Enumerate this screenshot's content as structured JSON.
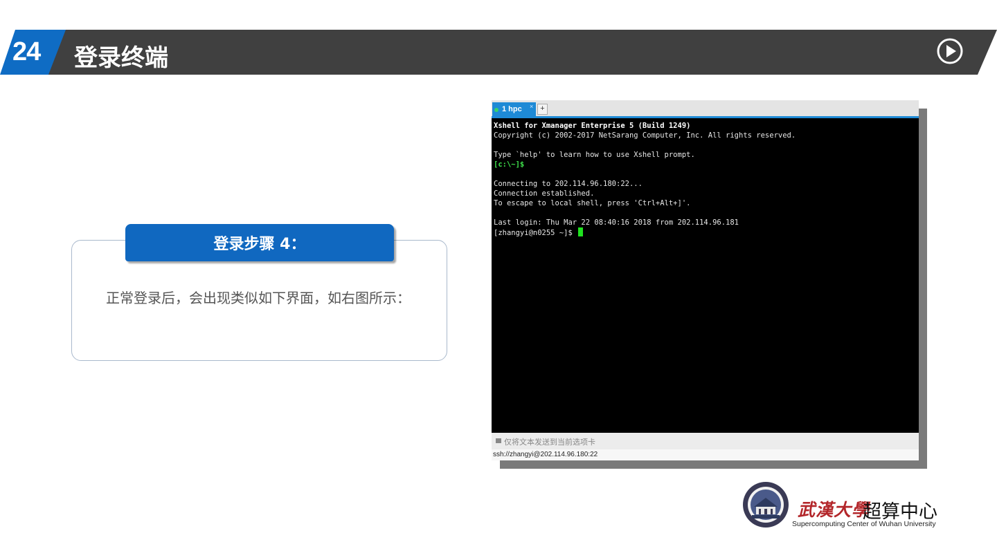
{
  "header": {
    "slide_number": "24",
    "title": "登录终端",
    "play_icon": "play-circle-icon"
  },
  "step_card": {
    "heading": "登录步骤 4：",
    "body": "正常登录后，会出现类似如下界面，如右图所示："
  },
  "terminal": {
    "tab_label": "1 hpc",
    "tab_close": "×",
    "tab_add": "+",
    "lines": [
      {
        "text": "Xshell for Xmanager Enterprise 5 (Build 1249)",
        "style": "bold"
      },
      {
        "text": "Copyright (c) 2002-2017 NetSarang Computer, Inc. All rights reserved.",
        "style": "normal"
      },
      {
        "text": "",
        "style": "normal"
      },
      {
        "text": "Type `help' to learn how to use Xshell prompt.",
        "style": "normal"
      },
      {
        "text": "[c:\\~]$",
        "style": "green"
      },
      {
        "text": "",
        "style": "normal"
      },
      {
        "text": "Connecting to 202.114.96.180:22...",
        "style": "normal"
      },
      {
        "text": "Connection established.",
        "style": "normal"
      },
      {
        "text": "To escape to local shell, press 'Ctrl+Alt+]'.",
        "style": "normal"
      },
      {
        "text": "",
        "style": "normal"
      },
      {
        "text": "Last login: Thu Mar 22 08:40:16 2018 from 202.114.96.181",
        "style": "normal"
      },
      {
        "text": "[zhangyi@n0255 ~]$ ",
        "style": "prompt"
      }
    ],
    "send_bar_text": "仅将文本发送到当前选项卡",
    "status_text": "ssh://zhangyi@202.114.96.180:22",
    "colors": {
      "tab_accent": "#1e8ad6",
      "cursor": "#1fe21f",
      "prompt_green": "#3fe24c"
    }
  },
  "logo": {
    "cn_calligraphy": "武漢大學",
    "cn_title": "超算中心",
    "en_title": "Supercomputing Center of Wuhan University",
    "seal_icon": "university-seal-icon"
  },
  "colors": {
    "header_dark": "#404040",
    "header_blue": "#0f6cc4",
    "card_blue": "#1068c0"
  }
}
